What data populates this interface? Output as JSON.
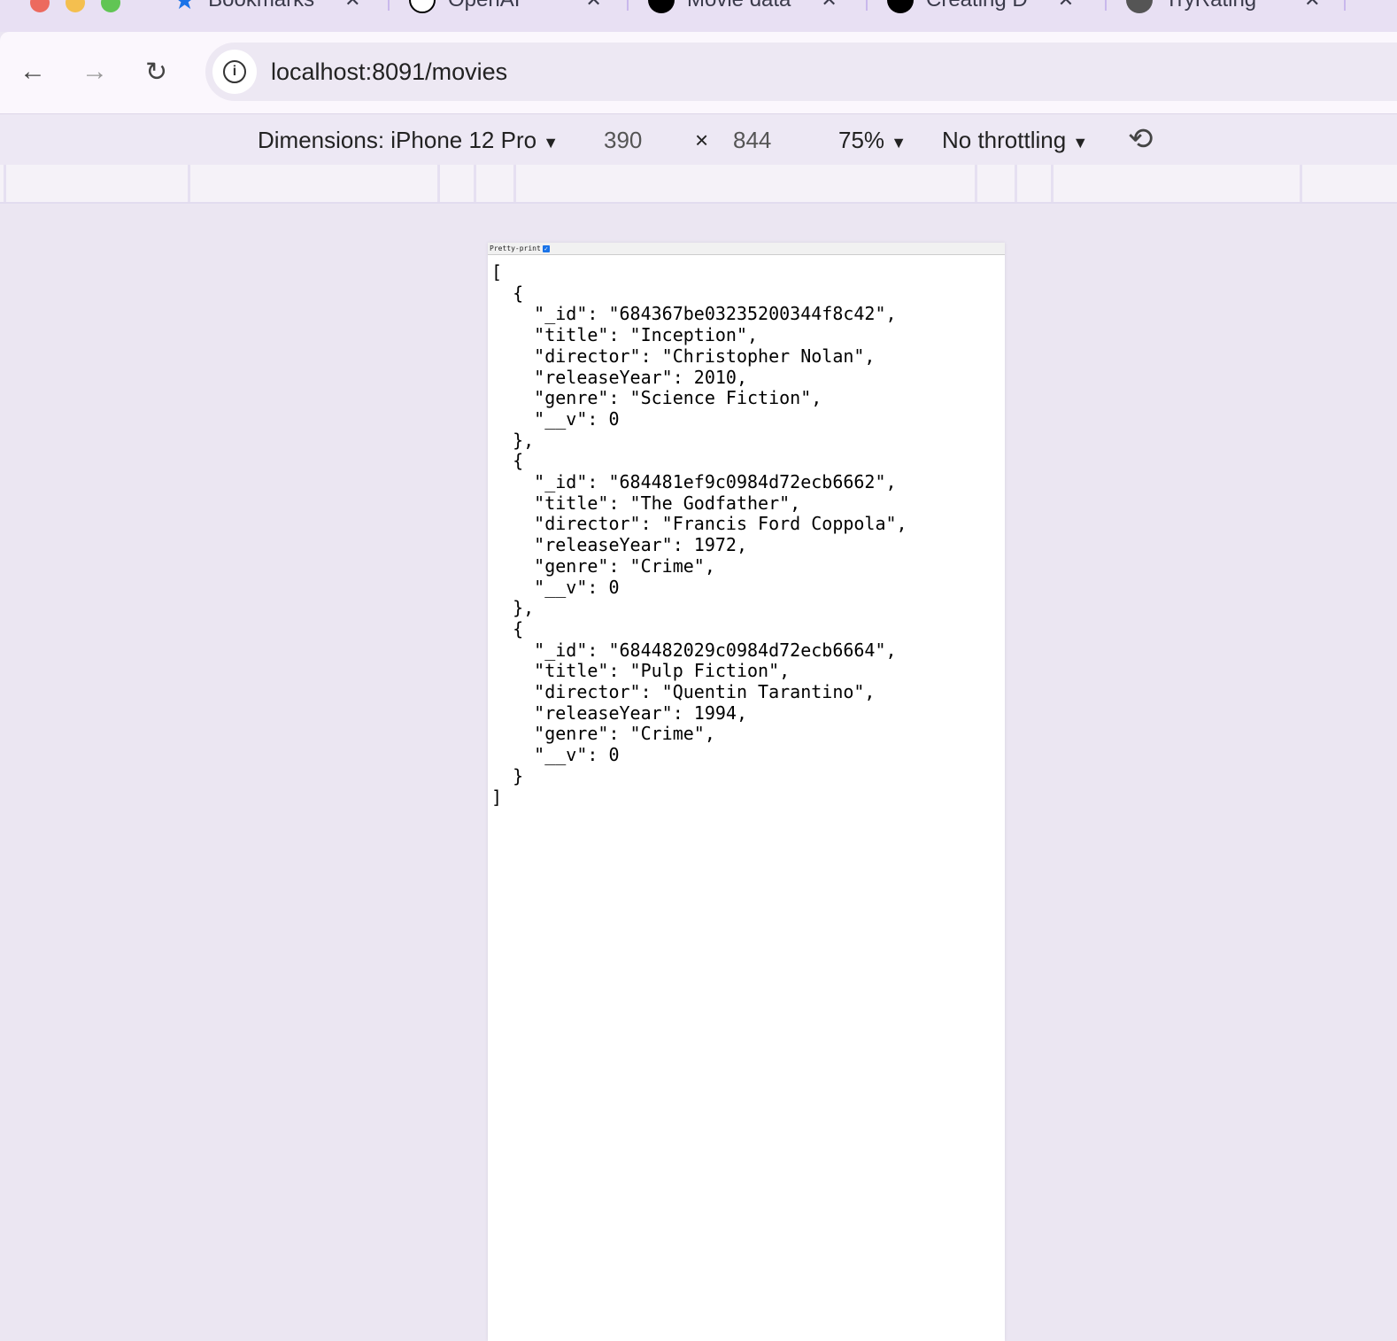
{
  "tabs": [
    {
      "label": "Bookmarks"
    },
    {
      "label": "OpenAI"
    },
    {
      "label": "Movie data"
    },
    {
      "label": "Creating D"
    },
    {
      "label": "TryRating"
    }
  ],
  "address": {
    "url": "localhost:8091/movies"
  },
  "device_toolbar": {
    "dimensions": "Dimensions: iPhone 12 Pro",
    "width": "390",
    "times": "×",
    "height": "844",
    "zoom": "75%",
    "throttling": "No throttling"
  },
  "viewer": {
    "pretty_print_label": "Pretty-print",
    "pretty_print_checked": true
  },
  "json_lines": [
    "[",
    "  {",
    "    \"_id\": \"684367be03235200344f8c42\",",
    "    \"title\": \"Inception\",",
    "    \"director\": \"Christopher Nolan\",",
    "    \"releaseYear\": 2010,",
    "    \"genre\": \"Science Fiction\",",
    "    \"__v\": 0",
    "  },",
    "  {",
    "    \"_id\": \"684481ef9c0984d72ecb6662\",",
    "    \"title\": \"The Godfather\",",
    "    \"director\": \"Francis Ford Coppola\",",
    "    \"releaseYear\": 1972,",
    "    \"genre\": \"Crime\",",
    "    \"__v\": 0",
    "  },",
    "  {",
    "    \"_id\": \"684482029c0984d72ecb6664\",",
    "    \"title\": \"Pulp Fiction\",",
    "    \"director\": \"Quentin Tarantino\",",
    "    \"releaseYear\": 1994,",
    "    \"genre\": \"Crime\",",
    "    \"__v\": 0",
    "  }",
    "]"
  ]
}
